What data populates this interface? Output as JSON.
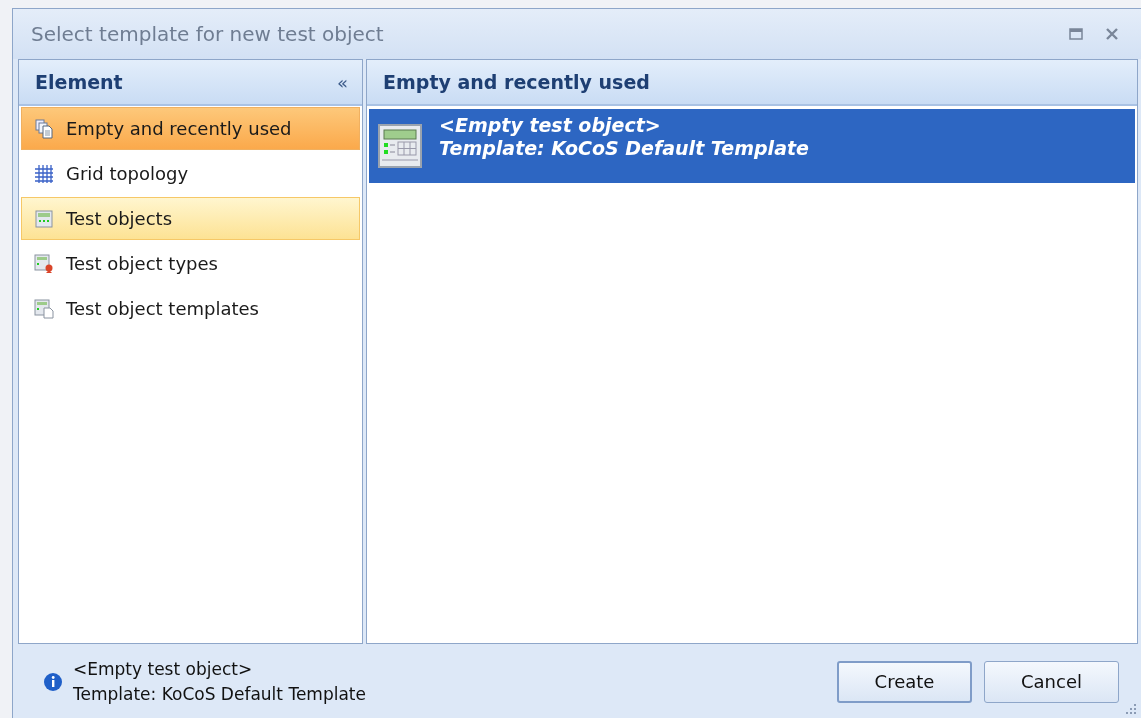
{
  "window": {
    "title": "Select template for new test object"
  },
  "sidebar": {
    "title": "Element",
    "collapse": "«",
    "items": [
      {
        "label": "Empty and recently used",
        "kind": "copies",
        "selected": true,
        "hot": false
      },
      {
        "label": "Grid topology",
        "kind": "grid",
        "selected": false,
        "hot": false
      },
      {
        "label": "Test objects",
        "kind": "device",
        "selected": false,
        "hot": true
      },
      {
        "label": "Test object types",
        "kind": "device-type",
        "selected": false,
        "hot": false
      },
      {
        "label": "Test object templates",
        "kind": "device-template",
        "selected": false,
        "hot": false
      }
    ]
  },
  "content": {
    "title": "Empty and recently used",
    "items": [
      {
        "name": "<Empty test object>",
        "template": "Template: KoCoS Default Template",
        "selected": true
      }
    ]
  },
  "footer": {
    "info_lines": [
      "<Empty test object>",
      "Template: KoCoS Default Template"
    ],
    "buttons": [
      "Create",
      "Cancel"
    ]
  }
}
